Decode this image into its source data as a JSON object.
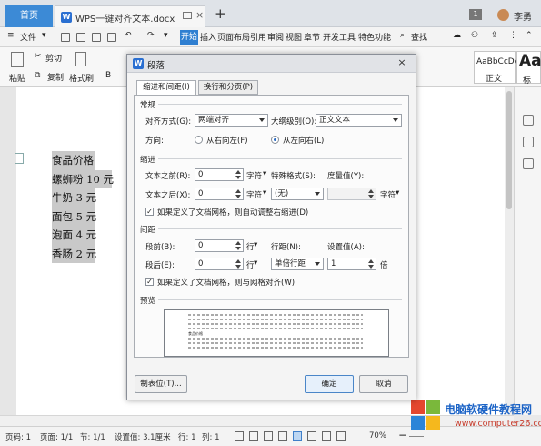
{
  "titlebar": {
    "home_tab": "首页",
    "doc_tab": "WPS一键对齐文本.docx",
    "new_tab": "+",
    "badge": "1",
    "user": "李勇"
  },
  "menubar": {
    "file": "文件",
    "items": [
      "开始",
      "插入",
      "页面布局",
      "引用",
      "审阅",
      "视图",
      "章节",
      "开发工具",
      "特色功能"
    ],
    "search": "查找"
  },
  "ribbon": {
    "paste": "粘贴",
    "cut": "剪切",
    "copy": "复制",
    "format_painter": "格式刷",
    "style1_preview": "AaBbCcDd",
    "style1_name": "正文",
    "style2_preview": "Aa",
    "style2_name": "标"
  },
  "document": {
    "lines": [
      "食品价格",
      "螺蛳粉 10 元",
      "牛奶 3 元",
      "面包 5 元",
      "泡面 4 元",
      "香肠 2 元"
    ]
  },
  "dialog": {
    "title": "段落",
    "close": "×",
    "tabs": [
      "缩进和间距(I)",
      "换行和分页(P)"
    ],
    "general": {
      "section": "常规",
      "align_label": "对齐方式(G):",
      "align_value": "两端对齐",
      "outline_label": "大纲级别(O):",
      "outline_value": "正文文本",
      "direction_label": "方向:",
      "rtl_label": "从右向左(F)",
      "ltr_label": "从左向右(L)"
    },
    "indent": {
      "section": "缩进",
      "before_label": "文本之前(R):",
      "before_value": "0",
      "before_unit": "字符",
      "after_label": "文本之后(X):",
      "after_value": "0",
      "after_unit": "字符",
      "special_label": "特殊格式(S):",
      "special_value": "(无)",
      "measure_label": "度量值(Y):",
      "measure_value": "",
      "measure_unit": "字符",
      "grid_check": "如果定义了文档网格，则自动调整右缩进(D)"
    },
    "spacing": {
      "section": "间距",
      "before_label": "段前(B):",
      "before_value": "0",
      "before_unit": "行",
      "after_label": "段后(E):",
      "after_value": "0",
      "after_unit": "行",
      "line_label": "行距(N):",
      "line_value": "单倍行距",
      "setting_label": "设置值(A):",
      "setting_value": "1",
      "setting_unit": "倍",
      "grid_check": "如果定义了文档网格，则与网格对齐(W)"
    },
    "preview": {
      "section": "预览",
      "sample": "食品价格"
    },
    "buttons": {
      "tabs": "制表位(T)...",
      "ok": "确定",
      "cancel": "取消"
    }
  },
  "statusbar": {
    "page_count": "页码: 1",
    "page": "页面: 1/1",
    "section": "节: 1/1",
    "position": "设置值: 3.1厘米",
    "row": "行: 1",
    "col": "列: 1",
    "zoom": "70%"
  },
  "watermark": {
    "line1": "电脑软硬件教程网",
    "line2": "www.computer26.com"
  }
}
